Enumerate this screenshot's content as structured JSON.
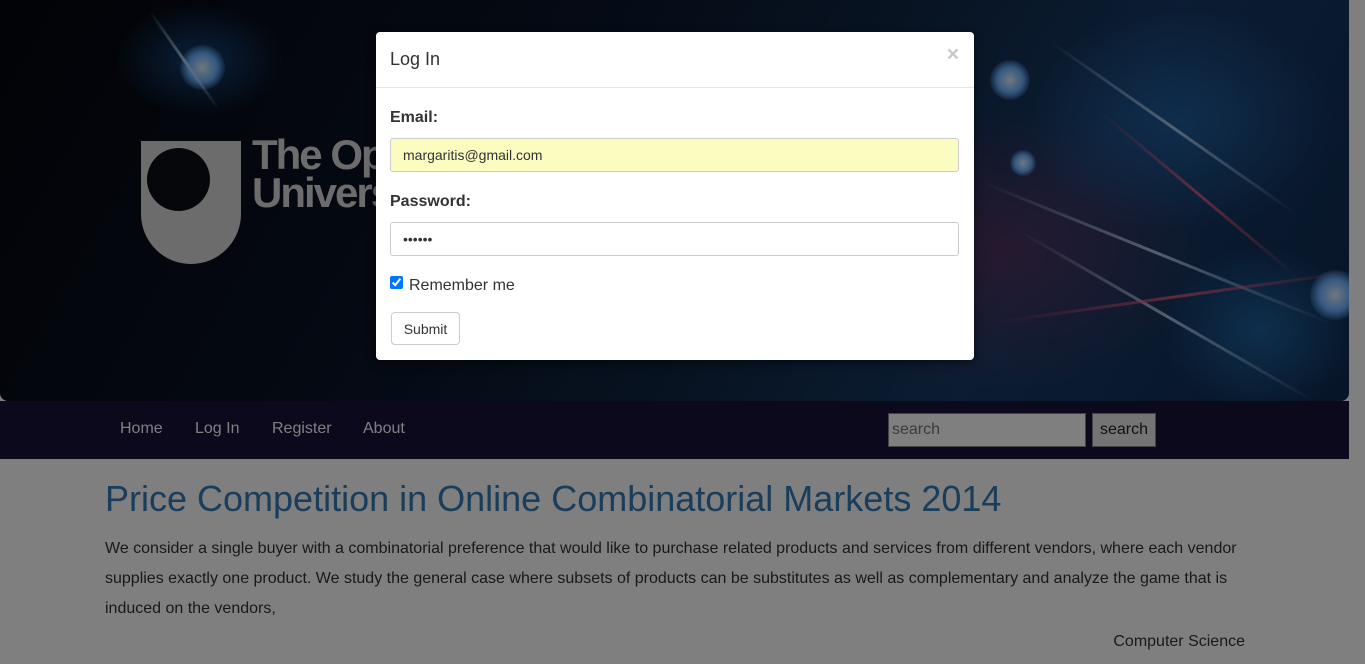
{
  "banner": {
    "logo_text_line1": "The Open",
    "logo_text_line2": "University"
  },
  "nav": {
    "items": [
      {
        "label": "Home"
      },
      {
        "label": "Log In"
      },
      {
        "label": "Register"
      },
      {
        "label": "About"
      }
    ],
    "search": {
      "placeholder": "search",
      "button_label": "search"
    }
  },
  "paper": {
    "title": "Price Competition in Online Combinatorial Markets 2014",
    "abstract": "We consider a single buyer with a combinatorial preference that would like to purchase related products and services from different vendors, where each vendor supplies exactly one product. We study the general case where subsets of products can be substitutes as well as complementary and analyze the game that is induced on the vendors,",
    "category": "Computer Science"
  },
  "login_modal": {
    "title": "Log In",
    "close_symbol": "×",
    "email_label": "Email:",
    "email_value": "margaritis@gmail.com",
    "password_label": "Password:",
    "password_value": "••••••",
    "remember_label": "Remember me",
    "remember_checked": true,
    "submit_label": "Submit"
  }
}
